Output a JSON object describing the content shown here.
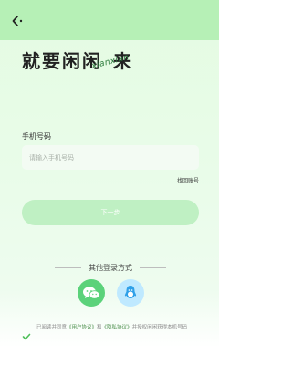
{
  "header": {
    "back_icon": "back-arrow-icon"
  },
  "hero": {
    "title_part1": "就要闲闲",
    "title_part2": "来",
    "script_text": "xianxian"
  },
  "form": {
    "phone_label": "手机号码",
    "phone_placeholder": "请输入手机号码",
    "phone_value": "",
    "find_account": "找回账号",
    "next_label": "下一步"
  },
  "other_login": {
    "title": "其他登录方式",
    "methods": [
      "wechat-icon",
      "qq-icon"
    ]
  },
  "agreement": {
    "checked": true,
    "text_prefix": "已阅读并同意",
    "user_agreement": "《用户协议》",
    "and": "和",
    "privacy_policy": "《隐私协议》",
    "text_suffix": "并授权闲闲获得本机号码"
  },
  "colors": {
    "topbar": "#b6f0b6",
    "button": "#bff0c3",
    "wechat": "#5bd27a",
    "qq": "#bfe9ff"
  }
}
